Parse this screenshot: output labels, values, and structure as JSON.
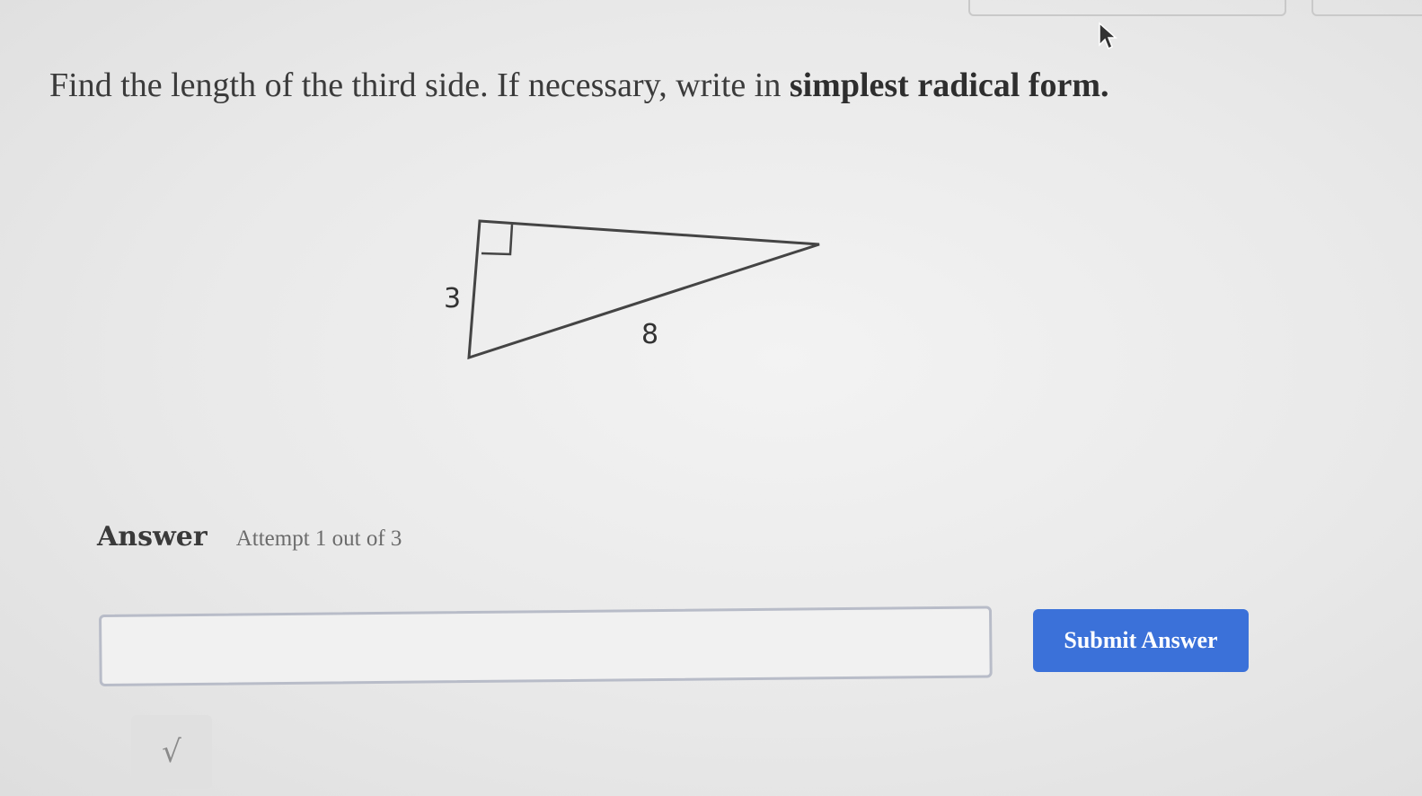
{
  "question": {
    "text_plain": "Find the length of the third side. If necessary, write in ",
    "text_bold": "simplest radical form."
  },
  "figure": {
    "leg_label": "3",
    "hypotenuse_label": "8"
  },
  "answer": {
    "label": "Answer",
    "attempt_text": "Attempt 1 out of 3",
    "input_value": "",
    "submit_label": "Submit Answer",
    "sqrt_label": "√"
  },
  "colors": {
    "accent": "#3b71d9"
  },
  "icons": {
    "cursor": "mouse-pointer-icon",
    "sqrt": "square-root-icon"
  }
}
